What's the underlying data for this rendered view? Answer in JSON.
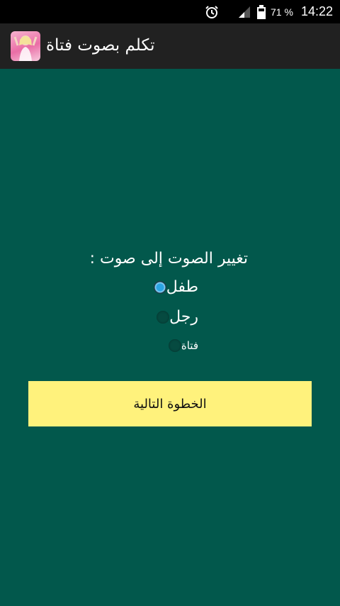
{
  "status_bar": {
    "battery_percent": "71 %",
    "time": "14:22",
    "icons": [
      "alarm-icon",
      "signal-icon",
      "battery-icon"
    ]
  },
  "app_bar": {
    "title": "تكلم بصوت فتاة",
    "icon": "app-girl-icon"
  },
  "voice_change": {
    "prompt": "تغيير الصوت إلى صوت :",
    "options": [
      {
        "label": "طفل",
        "selected": true
      },
      {
        "label": "رجل",
        "selected": false
      },
      {
        "label": "فتاة",
        "selected": false
      }
    ]
  },
  "next_button": {
    "label": "الخطوة التالية"
  },
  "colors": {
    "background": "#02584c",
    "app_bar": "#212121",
    "button": "#fff27c",
    "radio_selected": "#2aa4e2"
  }
}
